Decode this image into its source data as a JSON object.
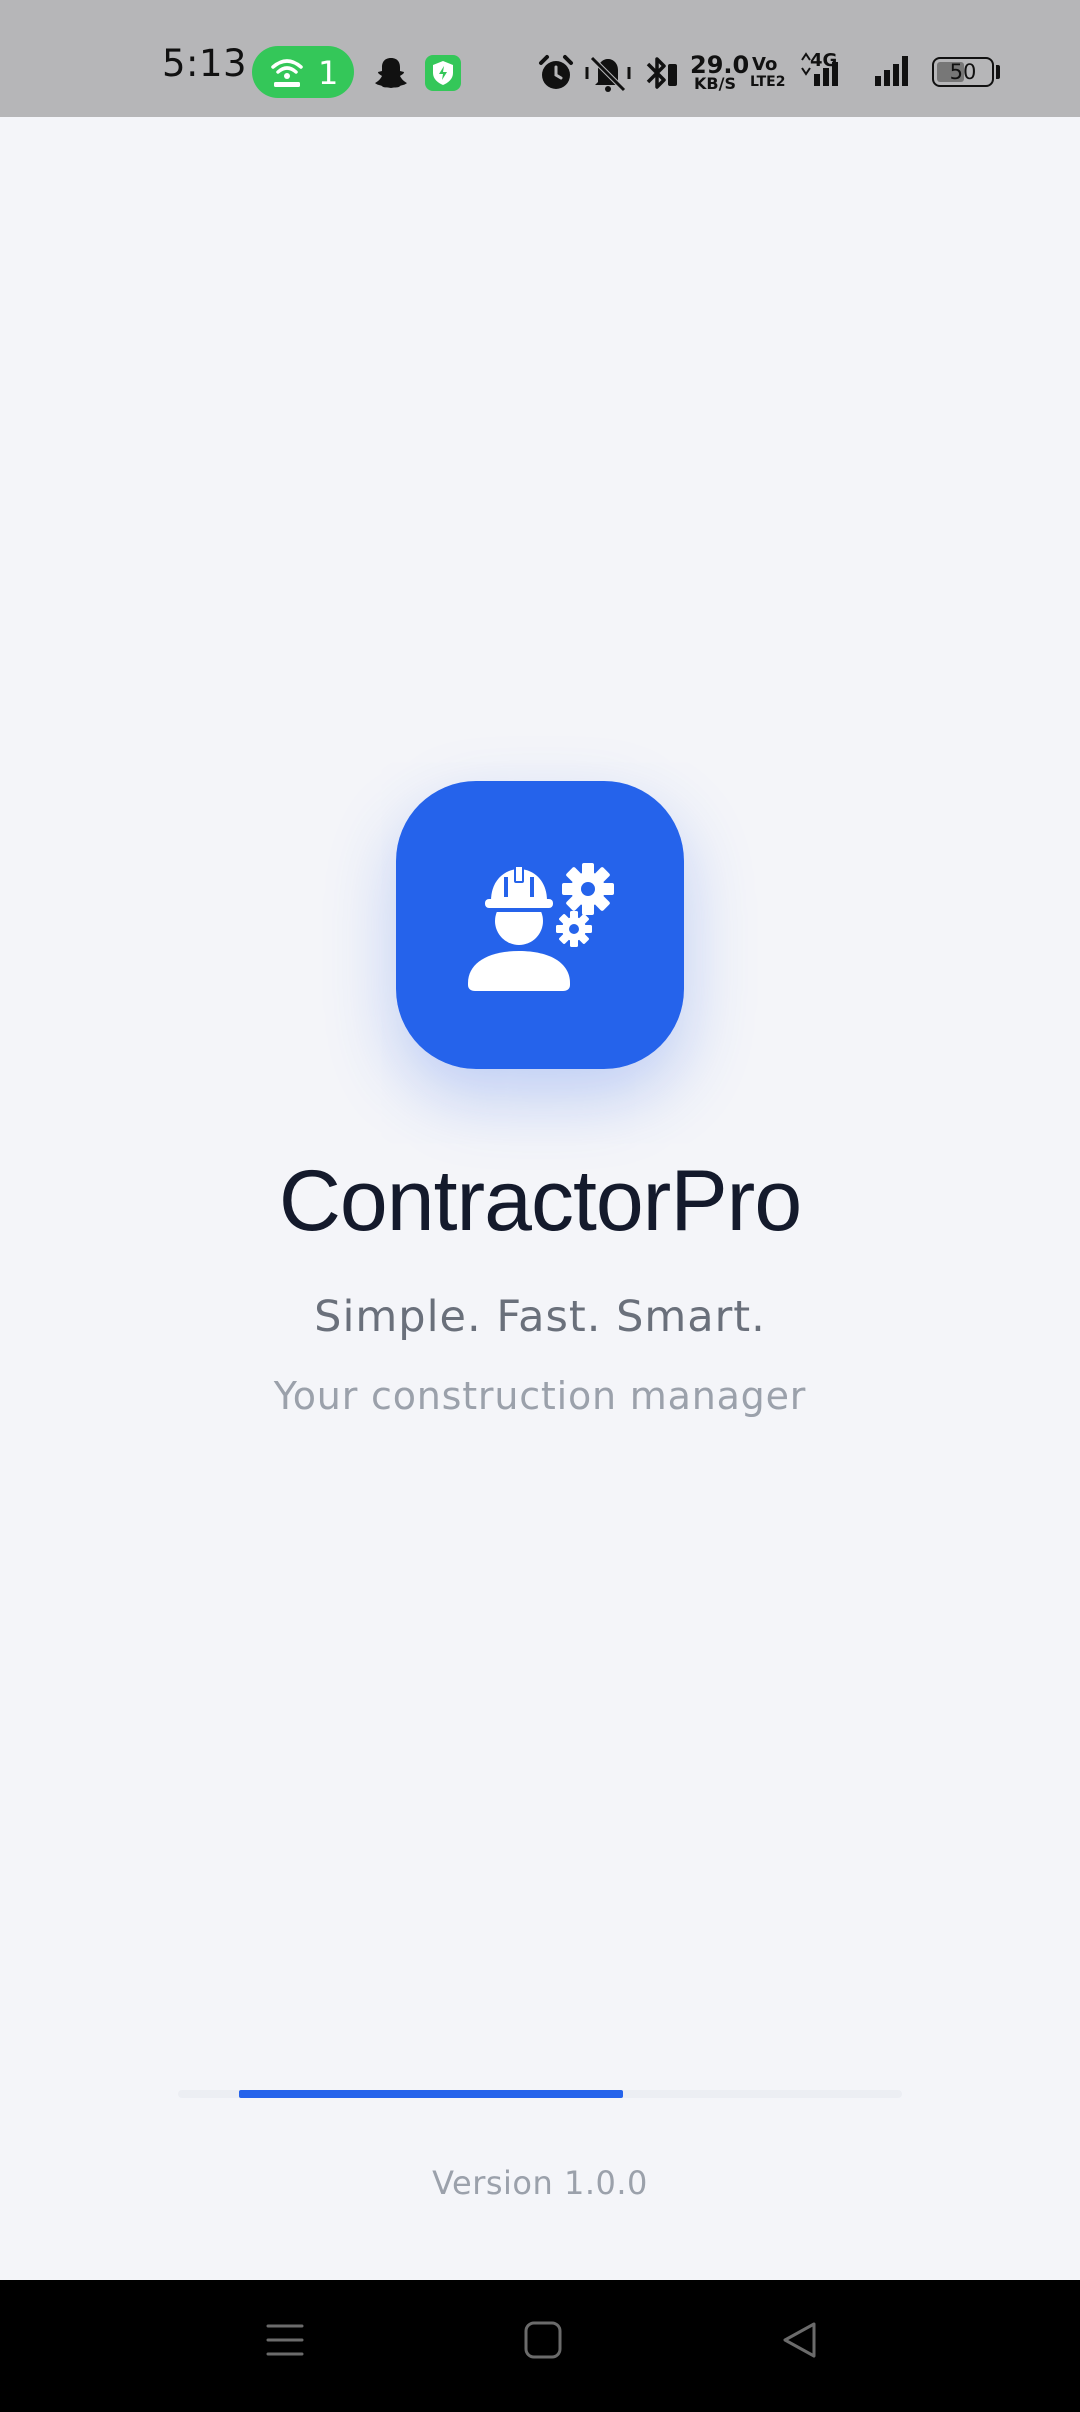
{
  "status_bar": {
    "time": "5:13",
    "hotspot_count": "1",
    "network_speed_value": "29.0",
    "network_speed_unit": "KB/S",
    "volte_top": "Vo",
    "volte_bottom": "LTE2",
    "network_type": "4G",
    "battery_level": "50",
    "icons": [
      "hotspot-icon",
      "snapchat-icon",
      "security-shield-icon",
      "alarm-icon",
      "vibrate-off-icon",
      "bluetooth-icon",
      "signal-icon",
      "battery-icon"
    ]
  },
  "app": {
    "name": "ContractorPro",
    "tagline": "Simple. Fast. Smart.",
    "subtagline": "Your construction manager",
    "version": "Version 1.0.0",
    "logo_icon": "engineer-gears-icon"
  },
  "loading": {
    "progress_fraction": 0.53
  },
  "navigation": {
    "buttons": [
      "menu-icon",
      "home-icon",
      "back-icon"
    ]
  },
  "colors": {
    "brand": "#2563eb",
    "status_bar": "#b6b6b8",
    "background": "#f4f5f9",
    "hotspot_pill": "#34c759"
  }
}
